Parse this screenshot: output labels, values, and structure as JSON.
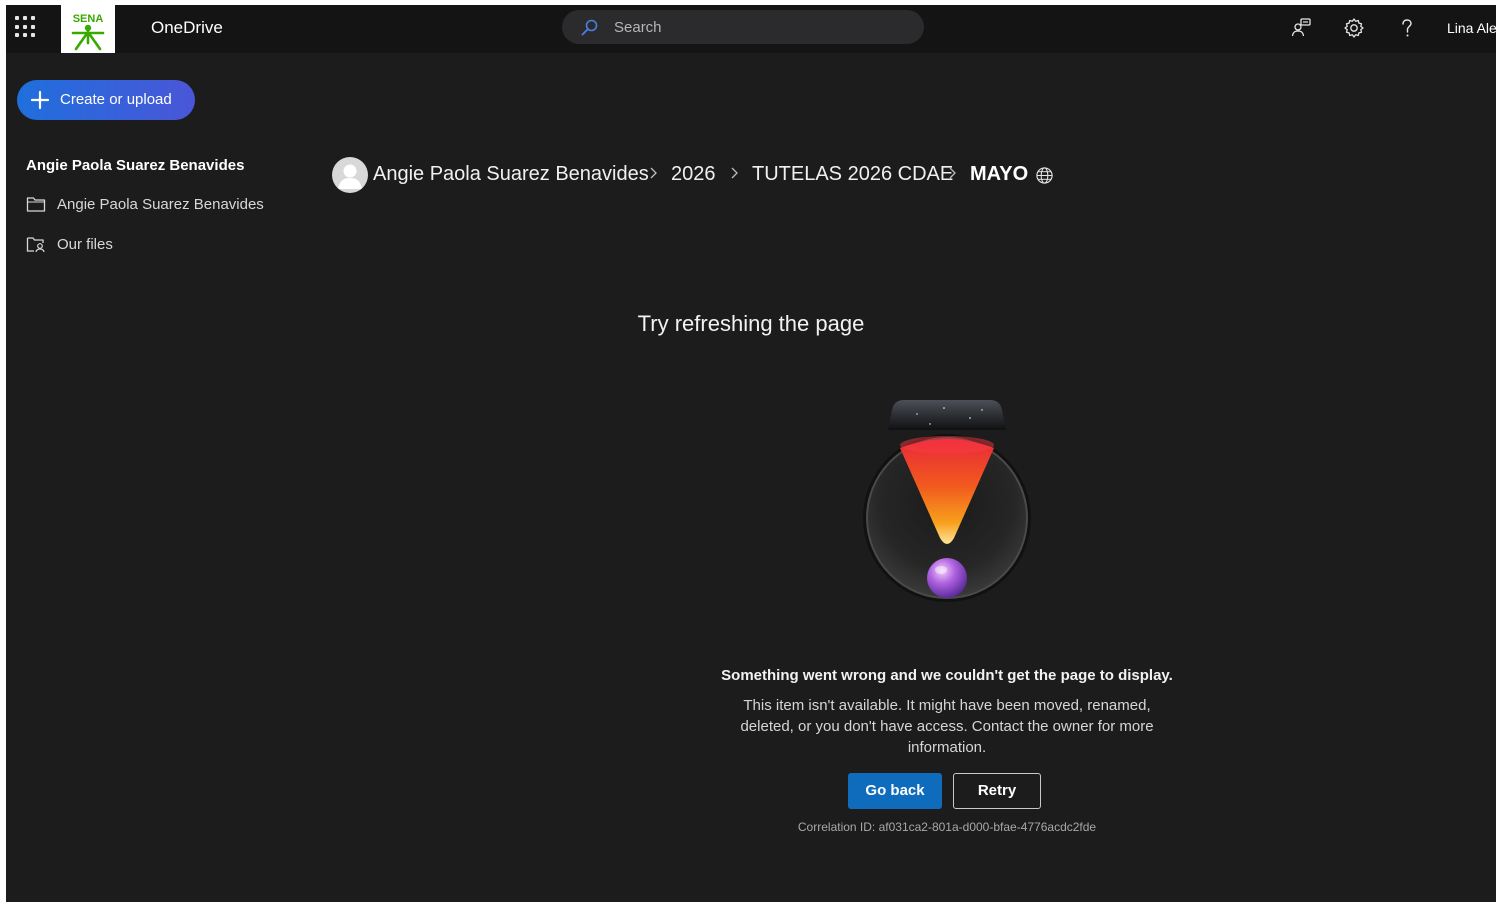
{
  "header": {
    "app_name": "OneDrive",
    "search_placeholder": "Search",
    "user_name": "Lina Ale",
    "icons": [
      "app-launcher-icon",
      "sena-logo",
      "search-icon",
      "share-people-icon",
      "gear-icon",
      "help-icon"
    ],
    "logo_text": "SENA",
    "logo_color": "#39a900"
  },
  "sidebar": {
    "create_label": "Create or upload",
    "section_title": "Angie Paola Suarez Benavides",
    "items": [
      {
        "label": "Angie Paola Suarez Benavides",
        "icon": "folder-icon"
      },
      {
        "label": "Our files",
        "icon": "shared-folder-icon"
      }
    ]
  },
  "breadcrumb": {
    "items": [
      "Angie Paola Suarez Benavides",
      "2026",
      "TUTELAS 2026 CDAE",
      "MAYO"
    ],
    "current_icon": "globe-icon"
  },
  "error": {
    "title": "Try refreshing the page",
    "heading": "Something went wrong and we couldn't get the page to display.",
    "description": "This item isn't available. It might have been moved, renamed, deleted, or you don't have access. Contact the owner for more information.",
    "go_back_label": "Go back",
    "retry_label": "Retry",
    "correlation": "Correlation ID: af031ca2-801a-d000-bfae-4776acdc2fde"
  },
  "colors": {
    "app_background": "#1c1c1c",
    "header_background": "#141414",
    "accent_blue": "#0f6cbd"
  }
}
